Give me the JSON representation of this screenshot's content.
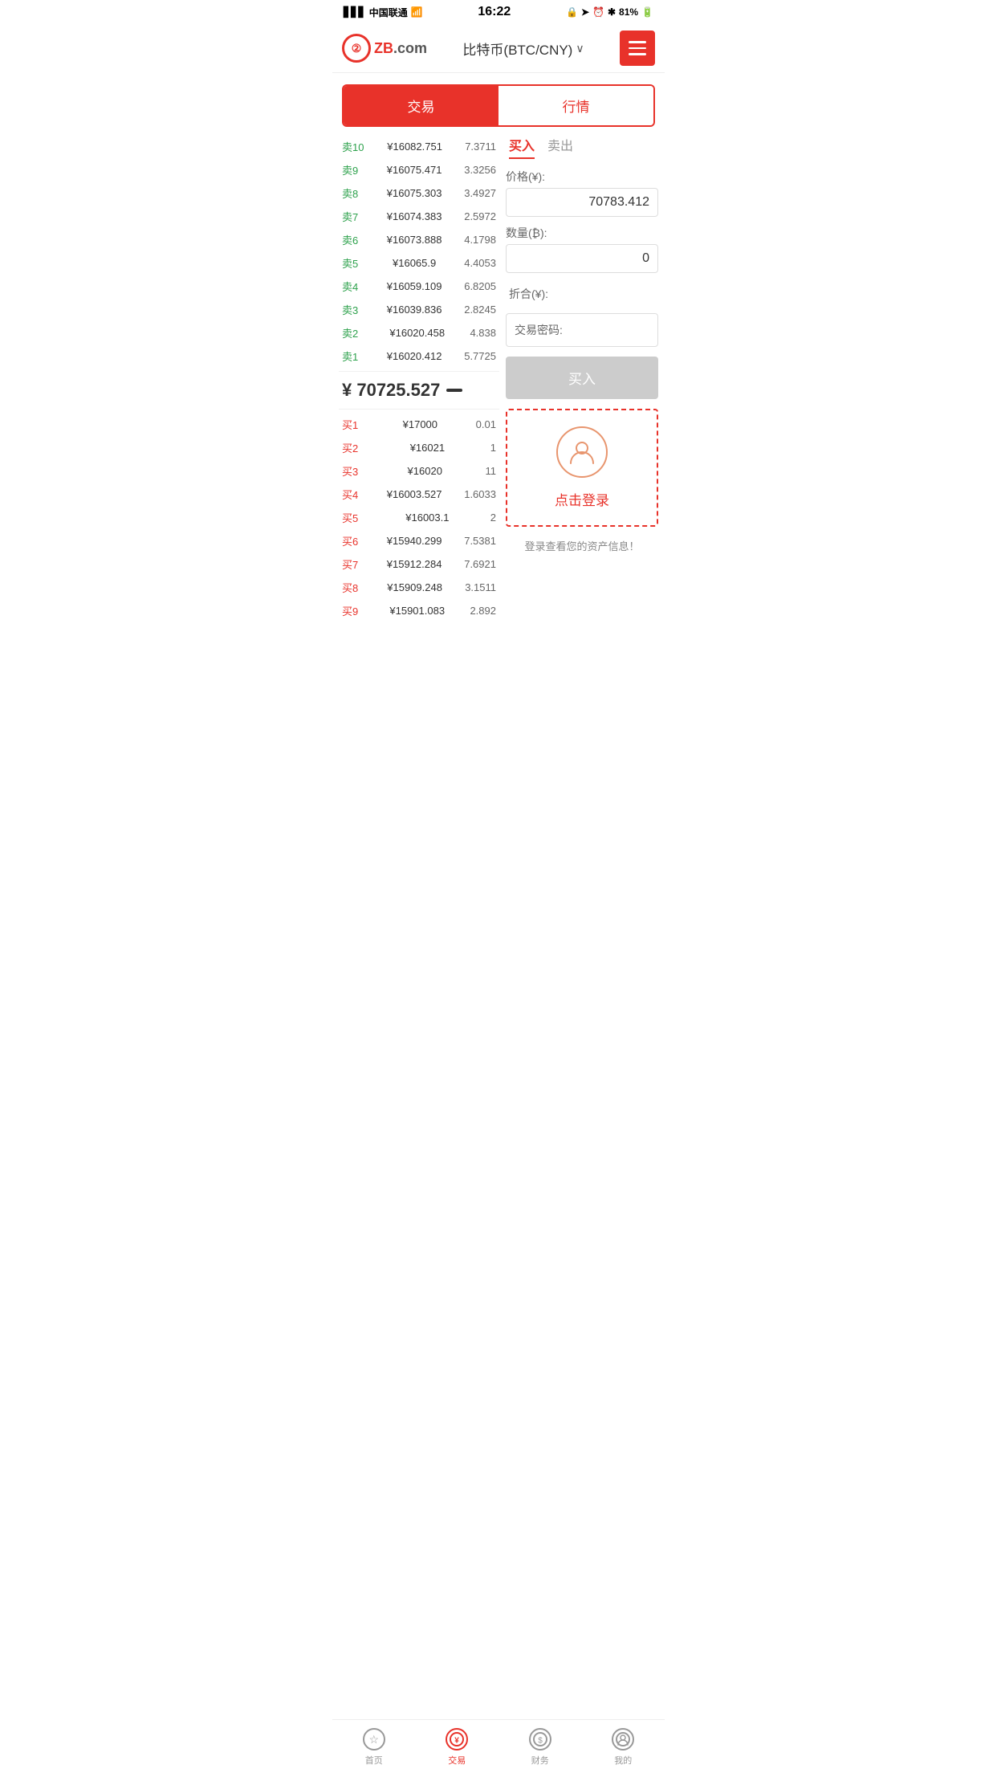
{
  "statusBar": {
    "carrier": "中国联通",
    "time": "16:22",
    "battery": "81%"
  },
  "header": {
    "logoText": "ZB",
    "logoDomain": ".com",
    "title": "比特币(BTC/CNY)",
    "menuAriaLabel": "菜单"
  },
  "mainTabs": [
    {
      "id": "trade",
      "label": "交易",
      "active": true
    },
    {
      "id": "market",
      "label": "行情",
      "active": false
    }
  ],
  "orderBook": {
    "sellOrders": [
      {
        "label": "卖10",
        "price": "¥16082.751",
        "qty": "7.3711"
      },
      {
        "label": "卖9",
        "price": "¥16075.471",
        "qty": "3.3256"
      },
      {
        "label": "卖8",
        "price": "¥16075.303",
        "qty": "3.4927"
      },
      {
        "label": "卖7",
        "price": "¥16074.383",
        "qty": "2.5972"
      },
      {
        "label": "卖6",
        "price": "¥16073.888",
        "qty": "4.1798"
      },
      {
        "label": "卖5",
        "price": "¥16065.9",
        "qty": "4.4053"
      },
      {
        "label": "卖4",
        "price": "¥16059.109",
        "qty": "6.8205"
      },
      {
        "label": "卖3",
        "price": "¥16039.836",
        "qty": "2.8245"
      },
      {
        "label": "卖2",
        "price": "¥16020.458",
        "qty": "4.838"
      },
      {
        "label": "卖1",
        "price": "¥16020.412",
        "qty": "5.7725"
      }
    ],
    "currentPrice": "¥ 70725.527",
    "priceDirection": "-",
    "buyOrders": [
      {
        "label": "买1",
        "price": "¥17000",
        "qty": "0.01"
      },
      {
        "label": "买2",
        "price": "¥16021",
        "qty": "1"
      },
      {
        "label": "买3",
        "price": "¥16020",
        "qty": "11"
      },
      {
        "label": "买4",
        "price": "¥16003.527",
        "qty": "1.6033"
      },
      {
        "label": "买5",
        "price": "¥16003.1",
        "qty": "2"
      },
      {
        "label": "买6",
        "price": "¥15940.299",
        "qty": "7.5381"
      },
      {
        "label": "买7",
        "price": "¥15912.284",
        "qty": "7.6921"
      },
      {
        "label": "买8",
        "price": "¥15909.248",
        "qty": "3.1511"
      },
      {
        "label": "买9",
        "price": "¥15901.083",
        "qty": "2.892"
      }
    ]
  },
  "tradePanel": {
    "buyTab": "买入",
    "sellTab": "卖出",
    "priceLabel": "价格(¥):",
    "priceValue": "70783.412",
    "qtyLabel": "数量(₿):",
    "qtyValue": "0",
    "zheheLabel": "折合(¥):",
    "zheheValue": "",
    "passwordLabel": "交易密码:",
    "buyBtnLabel": "买入",
    "loginPrompt": {
      "clickLogin": "点击登录",
      "hintText": "登录查看您的资产信息！"
    }
  },
  "bottomNav": [
    {
      "id": "home",
      "label": "首页",
      "icon": "★",
      "active": false
    },
    {
      "id": "trade",
      "label": "交易",
      "icon": "¥",
      "active": true
    },
    {
      "id": "finance",
      "label": "财务",
      "icon": "$",
      "active": false
    },
    {
      "id": "mine",
      "label": "我的",
      "icon": "👤",
      "active": false
    }
  ]
}
